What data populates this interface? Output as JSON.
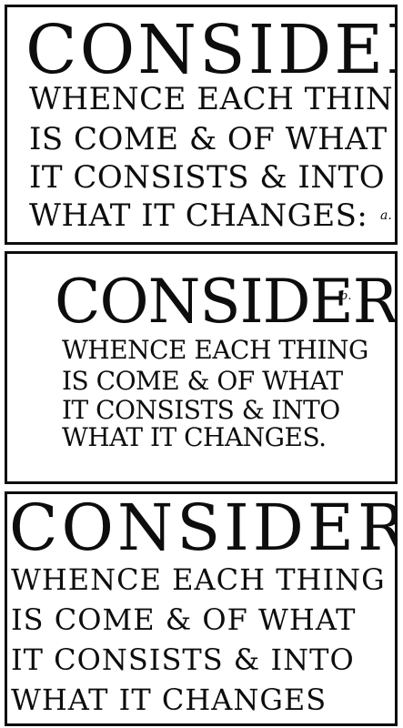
{
  "panels": [
    {
      "heading": "CONSIDER",
      "lines": [
        "WHENCE EACH THING",
        "IS COME & OF WHAT",
        "IT CONSISTS & INTO",
        "WHAT IT CHANGES:"
      ],
      "mark": "a."
    },
    {
      "heading": "CONSIDER",
      "lines": [
        "WHENCE EACH THING",
        "IS COME & OF WHAT",
        "IT CONSISTS & INTO",
        "WHAT IT CHANGES."
      ],
      "mark": "b."
    },
    {
      "heading": "CONSIDER",
      "lines": [
        "WHENCE EACH THING",
        "IS COME & OF WHAT",
        "IT CONSISTS & INTO",
        "WHAT IT CHANGES"
      ]
    }
  ]
}
